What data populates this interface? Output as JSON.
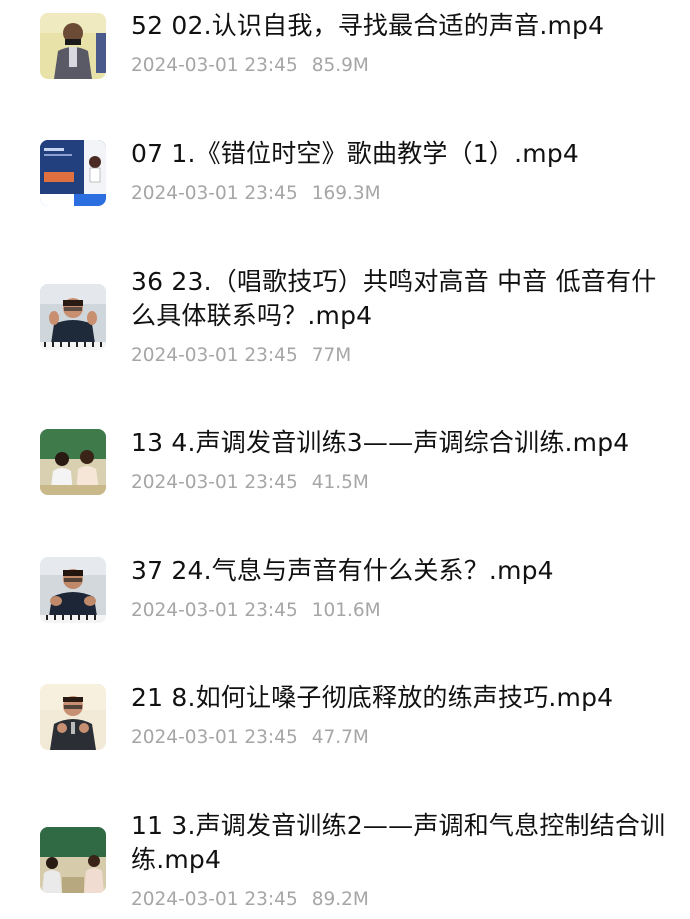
{
  "files": [
    {
      "name": "52 02.认识自我，寻找最合适的声音.mp4",
      "date": "2024-03-01 23:45",
      "size": "85.9M",
      "thumb_icon": "video-thumbnail-man-portrait"
    },
    {
      "name": "07 1.《错位时空》歌曲教学（1）.mp4",
      "date": "2024-03-01 23:45",
      "size": "169.3M",
      "thumb_icon": "video-thumbnail-blue-screen"
    },
    {
      "name": "36 23.（唱歌技巧）共鸣对高音 中音 低音有什么具体联系吗？.mp4",
      "date": "2024-03-01 23:45",
      "size": "77M",
      "thumb_icon": "video-thumbnail-teacher-piano"
    },
    {
      "name": "13 4.声调发音训练3——声调综合训练.mp4",
      "date": "2024-03-01 23:45",
      "size": "41.5M",
      "thumb_icon": "video-thumbnail-classroom"
    },
    {
      "name": "37 24.气息与声音有什么关系？.mp4",
      "date": "2024-03-01 23:45",
      "size": "101.6M",
      "thumb_icon": "video-thumbnail-teacher-piano"
    },
    {
      "name": "21 8.如何让嗓子彻底释放的练声技巧.mp4",
      "date": "2024-03-01 23:45",
      "size": "47.7M",
      "thumb_icon": "video-thumbnail-man-mic"
    },
    {
      "name": "11 3.声调发音训练2——声调和气息控制结合训练.mp4",
      "date": "2024-03-01 23:45",
      "size": "89.2M",
      "thumb_icon": "video-thumbnail-classroom-green"
    }
  ]
}
